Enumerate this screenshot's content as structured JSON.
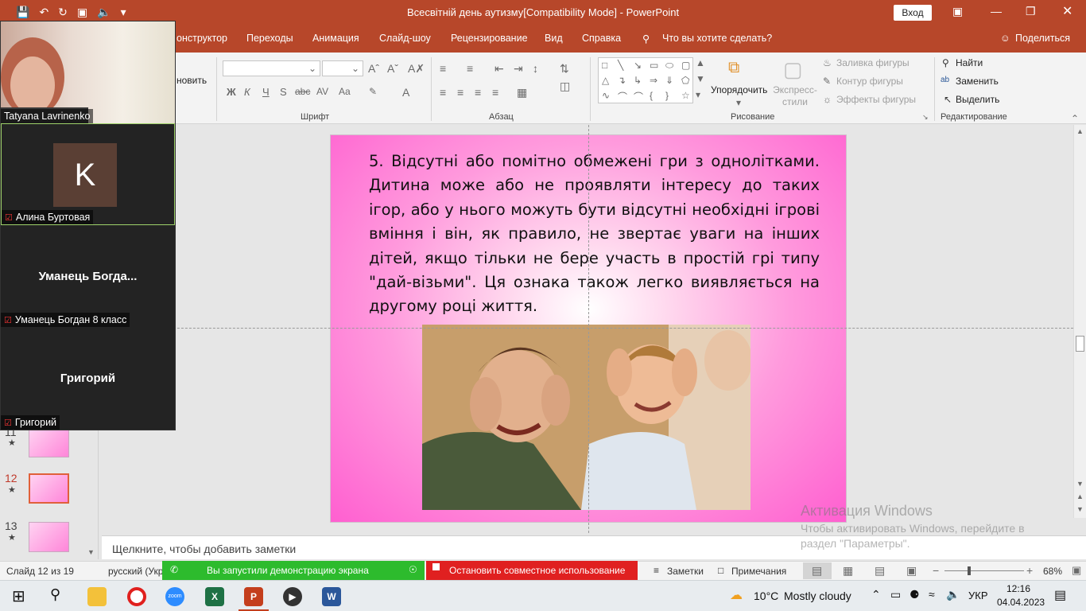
{
  "titlebar": {
    "title": "Всесвітній день аутизму[Compatibility Mode]  -  PowerPoint",
    "signin": "Вход"
  },
  "menu": {
    "tabs": [
      "онструктор",
      "Переходы",
      "Анимация",
      "Слайд-шоу",
      "Рецензирование",
      "Вид",
      "Справка"
    ],
    "tellme": "Что вы хотите сделать?",
    "share": "Поделиться"
  },
  "ribbon": {
    "groups": {
      "font": "Шрифт",
      "paragraph": "Абзац",
      "drawing": "Рисование",
      "editing": "Редактирование"
    },
    "clipboard_partial": "новить",
    "arrange": "Упорядочить",
    "quick_styles": "Экспресс-стили",
    "shape_fill": "Заливка фигуры",
    "shape_outline": "Контур фигуры",
    "shape_effects": "Эффекты фигуры",
    "find": "Найти",
    "replace": "Заменить",
    "select": "Выделить"
  },
  "slide": {
    "text": "5. Відсутні або помітно обмежені гри з однолітками. Дитина може або не проявляти інтересу до таких ігор, або у нього можуть бути відсутні необхідні ігрові вміння і він, як правило, не звертає уваги на інших дітей, якщо тільки не бере участь в простій грі типу \"дай-візьми\". Ця ознака також легко виявляється на другому році життя."
  },
  "thumbnails": [
    {
      "num": "11"
    },
    {
      "num": "12"
    },
    {
      "num": "13"
    }
  ],
  "notes": {
    "placeholder": "Щелкните, чтобы добавить заметки"
  },
  "watermark": {
    "title": "Активация Windows",
    "line1": "Чтобы активировать Windows, перейдите в",
    "line2": "раздел \"Параметры\"."
  },
  "statusbar": {
    "slide": "Слайд 12 из 19",
    "lang": "русский (Укр",
    "notes": "Заметки",
    "comments": "Примечания",
    "zoom": "68%"
  },
  "sharing": {
    "running": "Вы запустили демонстрацию экрана",
    "stop": "Остановить совместное использование"
  },
  "participants": [
    {
      "name": "Tatyana Lavrinenko"
    },
    {
      "name": "Алина Буртовая",
      "initial": "K"
    },
    {
      "name": "Уманець Богдан 8 класс",
      "short": "Уманець  Богда..."
    },
    {
      "name": "Григорий",
      "short": "Григорий"
    }
  ],
  "taskbar": {
    "temp": "10°C",
    "weather": "Mostly cloudy",
    "lang": "УКР",
    "time": "12:16",
    "date": "04.04.2023"
  },
  "colors": {
    "accent": "#b7472a",
    "share_green": "#2dbb2d",
    "share_red": "#e02020"
  }
}
